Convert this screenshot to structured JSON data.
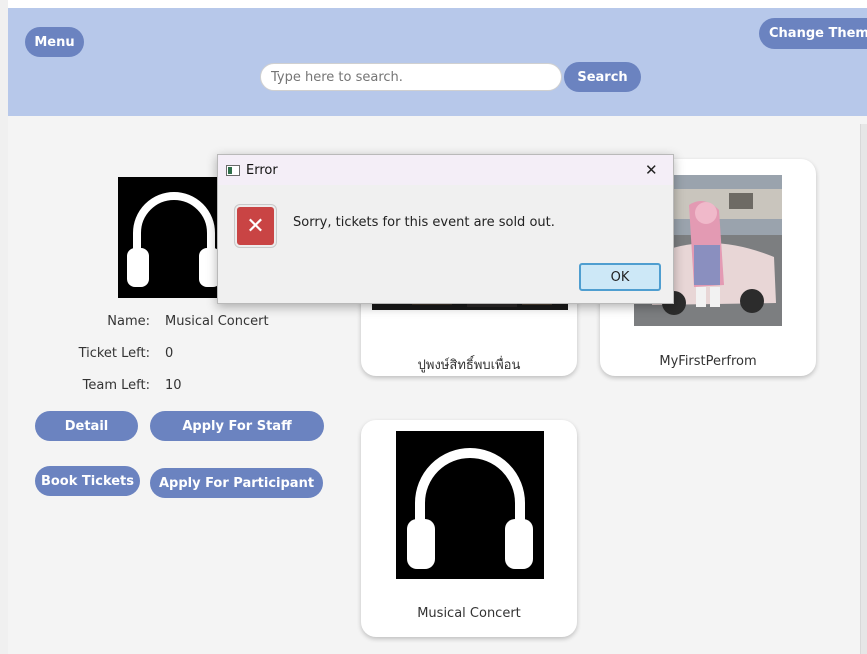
{
  "header": {
    "menu_label": "Menu",
    "theme_label": "Change Theme",
    "search_placeholder": "Type here to search.",
    "search_label": "Search"
  },
  "detail": {
    "name_label": "Name:",
    "name_value": "Musical Concert",
    "ticket_label": "Ticket Left:",
    "ticket_value": "0",
    "team_label": "Team Left:",
    "team_value": "10",
    "buttons": {
      "detail": "Detail",
      "staff": "Apply For Staff",
      "book": "Book Tickets",
      "participant": "Apply For Participant"
    }
  },
  "cards": [
    {
      "title": "ปูพงษ์สิทธิ์พบเพื่อน"
    },
    {
      "title": "MyFirstPerfrom"
    },
    {
      "title": "Musical Concert"
    }
  ],
  "dialog": {
    "title": "Error",
    "close": "✕",
    "icon": "✕",
    "message": "Sorry, tickets for this event are sold out.",
    "ok": "OK"
  },
  "colors": {
    "header_bg": "#b7c8ea",
    "button_bg": "#6b83c0",
    "error_red": "#c94444"
  }
}
